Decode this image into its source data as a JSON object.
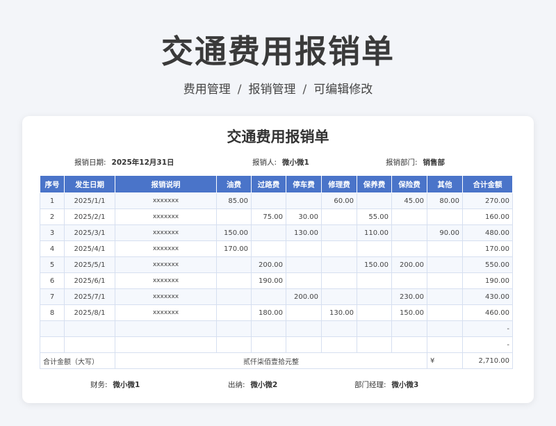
{
  "page": {
    "title": "交通费用报销单",
    "breadcrumb": [
      "费用管理",
      "报销管理",
      "可编辑修改"
    ],
    "breadcrumb_sep": "/"
  },
  "card": {
    "title": "交通费用报销单",
    "meta": {
      "date_label": "报销日期:",
      "date_value": "2025年12月31日",
      "person_label": "报销人:",
      "person_value": "微小微1",
      "dept_label": "报销部门:",
      "dept_value": "销售部"
    }
  },
  "table": {
    "headers": [
      "序号",
      "发生日期",
      "报销说明",
      "油费",
      "过路费",
      "停车费",
      "修理费",
      "保养费",
      "保险费",
      "其他",
      "合计金额"
    ],
    "rows": [
      [
        "1",
        "2025/1/1",
        "xxxxxxx",
        "85.00",
        "",
        "",
        "60.00",
        "",
        "45.00",
        "80.00",
        "270.00"
      ],
      [
        "2",
        "2025/2/1",
        "xxxxxxx",
        "",
        "75.00",
        "30.00",
        "",
        "55.00",
        "",
        "",
        "160.00"
      ],
      [
        "3",
        "2025/3/1",
        "xxxxxxx",
        "150.00",
        "",
        "130.00",
        "",
        "110.00",
        "",
        "90.00",
        "480.00"
      ],
      [
        "4",
        "2025/4/1",
        "xxxxxxx",
        "170.00",
        "",
        "",
        "",
        "",
        "",
        "",
        "170.00"
      ],
      [
        "5",
        "2025/5/1",
        "xxxxxxx",
        "",
        "200.00",
        "",
        "",
        "150.00",
        "200.00",
        "",
        "550.00"
      ],
      [
        "6",
        "2025/6/1",
        "xxxxxxx",
        "",
        "190.00",
        "",
        "",
        "",
        "",
        "",
        "190.00"
      ],
      [
        "7",
        "2025/7/1",
        "xxxxxxx",
        "",
        "",
        "200.00",
        "",
        "",
        "230.00",
        "",
        "430.00"
      ],
      [
        "8",
        "2025/8/1",
        "xxxxxxx",
        "",
        "180.00",
        "",
        "130.00",
        "",
        "150.00",
        "",
        "460.00"
      ],
      [
        "",
        "",
        "",
        "",
        "",
        "",
        "",
        "",
        "",
        "",
        "-"
      ],
      [
        "",
        "",
        "",
        "",
        "",
        "",
        "",
        "",
        "",
        "",
        "-"
      ]
    ],
    "total": {
      "label": "合计金额（大写）",
      "words": "贰仟柒佰壹拾元整",
      "currency": "¥",
      "amount": "2,710.00"
    }
  },
  "footer": {
    "finance_label": "财务:",
    "finance_value": "微小微1",
    "cashier_label": "出纳:",
    "cashier_value": "微小微2",
    "manager_label": "部门经理:",
    "manager_value": "微小微3"
  },
  "colors": {
    "header_bg": "#4a74c9",
    "page_bg": "#f3f5f9",
    "row_alt": "#f5f8fd"
  }
}
